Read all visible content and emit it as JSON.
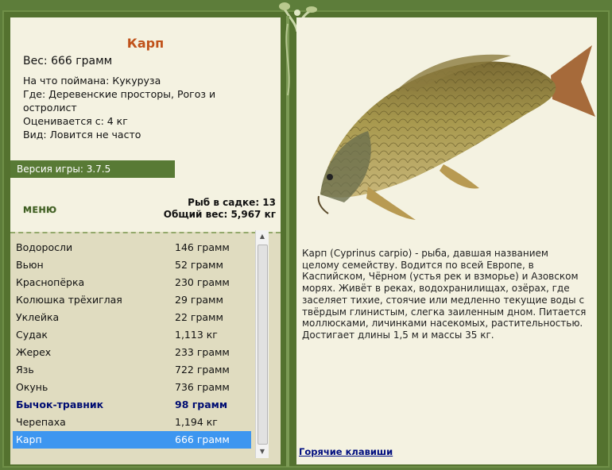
{
  "fish": {
    "title": "Карп",
    "weight": "Вес: 666 грамм",
    "caught_on": "На что поймана: Кукуруза",
    "where": "Где: Деревенские просторы, Рогоз и остролист",
    "price": "Оценивается с: 4 кг",
    "kind": "Вид: Ловится не часто"
  },
  "version": "Версия игры: 3.7.5",
  "menu_label": "МЕНЮ",
  "stats": {
    "fish_in_net": "Рыб в садке: 13",
    "total_weight": "Общий вес: 5,967 кг"
  },
  "catch_list": [
    {
      "name": "Водоросли",
      "weight": "146 грамм"
    },
    {
      "name": "Вьюн",
      "weight": "52 грамм"
    },
    {
      "name": "Краснопёрка",
      "weight": "230 грамм"
    },
    {
      "name": "Колюшка трёхиглая",
      "weight": "29 грамм"
    },
    {
      "name": "Уклейка",
      "weight": "22 грамм"
    },
    {
      "name": "Судак",
      "weight": "1,113 кг"
    },
    {
      "name": "Жерех",
      "weight": "233 грамм"
    },
    {
      "name": "Язь",
      "weight": "722 грамм"
    },
    {
      "name": "Окунь",
      "weight": "736 грамм"
    },
    {
      "name": "Бычок-травник",
      "weight": "98 грамм"
    },
    {
      "name": "Черепаха",
      "weight": "1,194 кг"
    },
    {
      "name": "Карп",
      "weight": "666 грамм"
    }
  ],
  "description": "Карп (Cyprinus carpio) - рыба, давшая названием целому семейству. Водится по всей Европе, в Каспийском, Чёрном (устья рек и взморье) и Азовском морях. Живёт в реках, водохранилищах, озёрах, где заселяет тихие, стоячие или медленно текущие воды с твёрдым глинистым, слегка заиленным дном. Питается моллюсками, личинками насекомых, растительностью. Достигает длины 1,5 м и массы 35 кг.",
  "hotkeys_label": "Горячие клавиши",
  "colors": {
    "frame": "#5d7d3a",
    "panel": "#f4f2e1",
    "list_bg": "#e0dcc0",
    "title": "#c0521a",
    "selected_row": "#3d96f0",
    "highlight_text": "#000d72"
  }
}
